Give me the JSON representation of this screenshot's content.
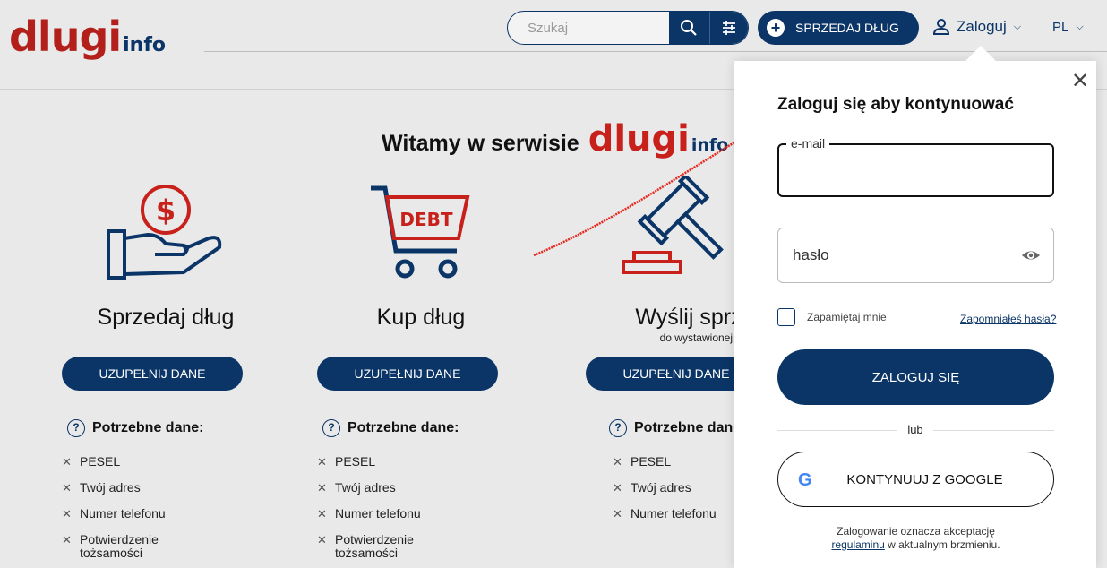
{
  "header": {
    "logo_main": "dlugi",
    "logo_sub": "info",
    "search_placeholder": "Szukaj",
    "sell_label": "SPRZEDAJ DŁUG",
    "login_label": "Zaloguj",
    "lang_label": "PL"
  },
  "welcome": {
    "text": "Witamy w serwisie",
    "logo_main": "dlugi",
    "logo_sub": "info"
  },
  "columns": [
    {
      "title": "Sprzedaj dług",
      "subtitle": "",
      "button": "UZUPEŁNIJ DANE",
      "req_title": "Potrzebne dane:",
      "items": [
        "PESEL",
        "Twój adres",
        "Numer telefonu",
        "Potwierdzenie tożsamości"
      ]
    },
    {
      "title": "Kup dług",
      "subtitle": "",
      "button": "UZUPEŁNIJ DANE",
      "req_title": "Potrzebne dane:",
      "items": [
        "PESEL",
        "Twój adres",
        "Numer telefonu",
        "Potwierdzenie tożsamości"
      ]
    },
    {
      "title": "Wyślij sprzeciw",
      "subtitle": "do wystawionej oferty",
      "button": "UZUPEŁNIJ DANE",
      "req_title": "Potrzebne dane:",
      "items": [
        "PESEL",
        "Twój adres",
        "Numer telefonu"
      ]
    }
  ],
  "illustrations": {
    "cart_text": "DEBT",
    "icons": [
      "money-hand-icon",
      "debt-cart-icon",
      "gavel-icon"
    ]
  },
  "modal": {
    "close": "✕",
    "title": "Zaloguj się aby kontynuować",
    "email_label": "e-mail",
    "email_value": "",
    "password_placeholder": "hasło",
    "remember_label": "Zapamiętaj mnie",
    "forgot_label": "Zapomniałeś hasła?",
    "login_button": "ZALOGUJ SIĘ",
    "or_label": "lub",
    "google_button": "KONTYNUUJ Z GOOGLE",
    "google_letter": "G",
    "terms_prefix": "Zalogowanie oznacza akceptację",
    "terms_link": "regulaminu",
    "terms_suffix": "w aktualnym brzmieniu."
  },
  "colors": {
    "brand_red": "#c8201b",
    "brand_navy": "#0b3567",
    "annotation_arrow": "#e8271d"
  }
}
